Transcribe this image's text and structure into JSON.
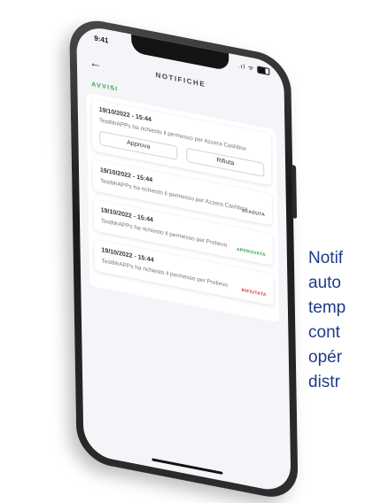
{
  "status_bar": {
    "time": "9:41",
    "signal": ".ıl",
    "wifi": "ᯤ"
  },
  "header": {
    "back_icon": "arrow-left-icon",
    "title": "NOTIFICHE"
  },
  "section": {
    "label": "AVVISI"
  },
  "notifications": [
    {
      "date": "19/10/2022 - 15:44",
      "message": "TestMrAPPs ha richiesto il permesso per Azzera Cashbox",
      "status": "",
      "status_color": "",
      "actions": {
        "approve": "Approva",
        "reject": "Rifiuta"
      }
    },
    {
      "date": "19/10/2022 - 15:44",
      "message": "TestMrAPPs ha richiesto il permesso per Azzera Cashbox",
      "status": "SCADUTA",
      "status_color": "#555555"
    },
    {
      "date": "19/10/2022 - 15:44",
      "message": "TestMrAPPs ha richiesto il permesso per Prelievo",
      "status": "APPROVATA",
      "status_color": "#3aa24a"
    },
    {
      "date": "19/10/2022 - 15:44",
      "message": "TestMrAPPs ha richiesto il permesso per Prelievo",
      "status": "RIFIUTATA",
      "status_color": "#e0343a"
    }
  ],
  "caption": [
    "Notif",
    "auto",
    "temp",
    "cont",
    "opér",
    "distr"
  ],
  "colors": {
    "accent_green": "#3aa24a",
    "caption_blue": "#1f3a8c"
  }
}
